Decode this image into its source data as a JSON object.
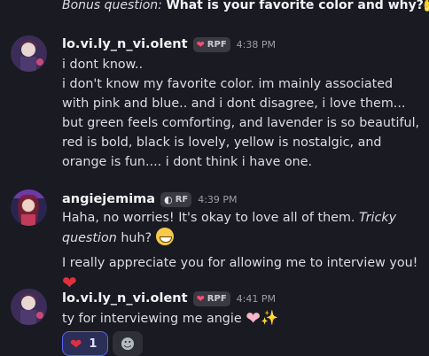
{
  "top": {
    "prefix": "Bonus question: ",
    "question": "What is your favorite color and why?",
    "emoji": "thinking-face-icon"
  },
  "messages": [
    {
      "username": "lo.vi.ly_n_vi.olent",
      "tag": "RPF",
      "tag_icon": "fire-heart-icon",
      "time": "4:38 PM",
      "lines": [
        "i dont know..",
        "i don't know my favorite color. im mainly associated with pink and blue.. and i dont disagree, i love them... but green feels comforting, and lavender is so beautiful, red is bold, black is lovely, yellow is nostalgic, and orange is fun.... i dont think i have one."
      ]
    },
    {
      "username": "angiejemima",
      "tag": "RF",
      "tag_icon": "moon-icon",
      "time": "4:39 PM",
      "line1_a": "Haha, no worries! It's okay to love all of them. ",
      "line1_italic": "Tricky question",
      "line1_b": " huh?",
      "line2": "I really appreciate you for allowing me to interview you!"
    },
    {
      "username": "lo.vi.ly_n_vi.olent",
      "tag": "RPF",
      "tag_icon": "fire-heart-icon",
      "time": "4:41 PM",
      "line": "ty for interviewing me angie",
      "reaction_count": "1"
    }
  ],
  "colors": {
    "background": "#1a1a22",
    "reaction_active_border": "#5865f2",
    "heart_red": "#e0303e",
    "heart_pink": "#f5b8c8"
  }
}
